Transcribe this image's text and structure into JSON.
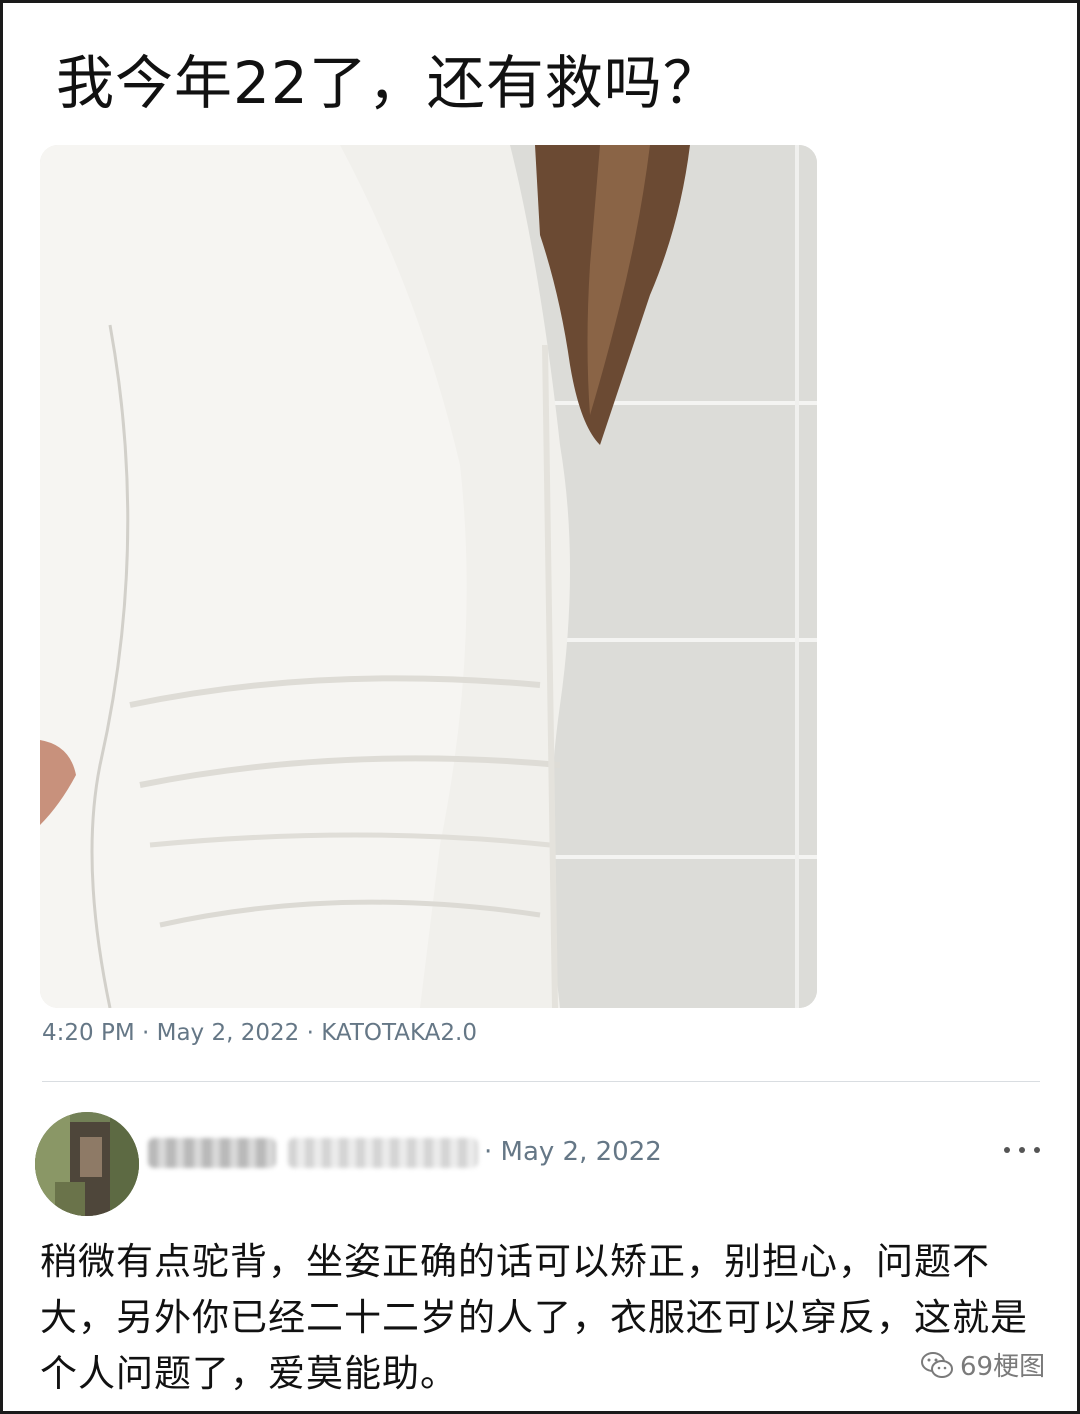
{
  "post": {
    "title": "我今年22了，还有救吗？",
    "meta": "4:20 PM · May 2, 2022 · KATOTAKA2.0"
  },
  "reply": {
    "date": "· May 2, 2022",
    "text": "稍微有点驼背，坐姿正确的话可以矫正，别担心，问题不大，另外你已经二十二岁的人了，衣服还可以穿反，这就是个人问题了，爱莫能助。"
  },
  "watermark": {
    "icon": "wechat-icon",
    "label": "69梗图"
  },
  "icons": {
    "more": "more-options-icon",
    "avatar": "avatar"
  }
}
